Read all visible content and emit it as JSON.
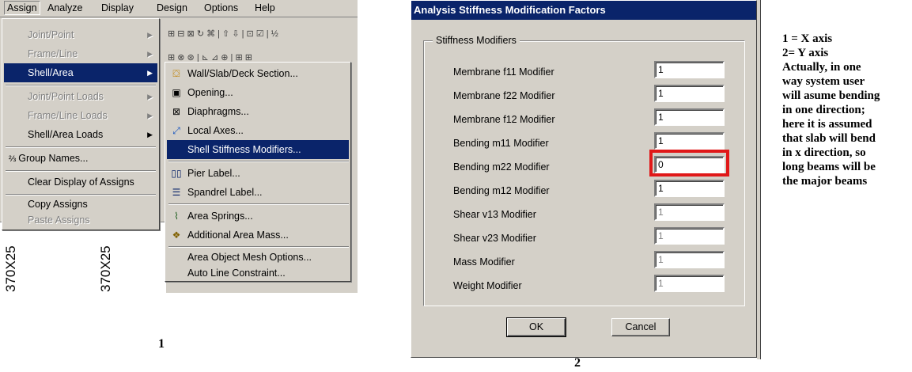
{
  "menubar": {
    "items": [
      "Assign",
      "Analyze",
      "Display",
      "Design",
      "Options",
      "Help"
    ]
  },
  "assign_menu": {
    "items": [
      {
        "label": "Joint/Point",
        "enabled": false,
        "submenu": true
      },
      {
        "label": "Frame/Line",
        "enabled": false,
        "submenu": true
      },
      {
        "label": "Shell/Area",
        "enabled": true,
        "submenu": true,
        "selected": true
      },
      {
        "label": "Joint/Point Loads",
        "enabled": false,
        "submenu": true
      },
      {
        "label": "Frame/Line Loads",
        "enabled": false,
        "submenu": true
      },
      {
        "label": "Shell/Area Loads",
        "enabled": true,
        "submenu": true
      },
      {
        "label": "Group Names...",
        "enabled": true
      },
      {
        "label": "Clear Display of Assigns",
        "enabled": true
      },
      {
        "label": "Copy Assigns",
        "enabled": true
      },
      {
        "label": "Paste Assigns",
        "enabled": false
      }
    ]
  },
  "shell_submenu": {
    "items": [
      {
        "label": "Wall/Slab/Deck Section...",
        "icon": "wall-slab-icon"
      },
      {
        "label": "Opening...",
        "icon": "opening-icon"
      },
      {
        "label": "Diaphragms...",
        "icon": "diaphragm-icon"
      },
      {
        "label": "Local Axes...",
        "icon": "local-axes-icon"
      },
      {
        "label": "Shell Stiffness Modifiers...",
        "icon": "",
        "selected": true
      },
      {
        "label": "Pier Label...",
        "icon": "pier-icon"
      },
      {
        "label": "Spandrel Label...",
        "icon": "spandrel-icon"
      },
      {
        "label": "Area Springs...",
        "icon": "springs-icon"
      },
      {
        "label": "Additional Area Mass...",
        "icon": "mass-icon"
      },
      {
        "label": "Area Object Mesh Options...",
        "icon": ""
      },
      {
        "label": "Auto Line Constraint...",
        "icon": ""
      }
    ]
  },
  "background_labels": {
    "section_a": "370X25",
    "section_b": "370X25"
  },
  "figure_labels": {
    "left": "1",
    "dialog": "2"
  },
  "dialog": {
    "title": "Analysis Stiffness Modification Factors",
    "group_label": "Stiffness Modifiers",
    "rows": [
      {
        "label": "Membrane f11 Modifier",
        "value": "1",
        "enabled": true
      },
      {
        "label": "Membrane f22 Modifier",
        "value": "1",
        "enabled": true
      },
      {
        "label": "Membrane f12 Modifier",
        "value": "1",
        "enabled": true
      },
      {
        "label": "Bending  m11 Modifier",
        "value": "1",
        "enabled": true
      },
      {
        "label": "Bending  m22 Modifier",
        "value": "0",
        "enabled": true,
        "highlighted": true
      },
      {
        "label": "Bending  m12 Modifier",
        "value": "1",
        "enabled": true
      },
      {
        "label": "Shear  v13 Modifier",
        "value": "1",
        "enabled": false
      },
      {
        "label": "Shear  v23 Modifier",
        "value": "1",
        "enabled": false
      },
      {
        "label": "Mass Modifier",
        "value": "1",
        "enabled": false
      },
      {
        "label": "Weight Modifier",
        "value": "1",
        "enabled": false
      }
    ],
    "ok_label": "OK",
    "cancel_label": "Cancel",
    "highlight_color": "#e01818"
  },
  "notes": {
    "lines": [
      "1 = X axis",
      "2= Y axis",
      "Actually, in one",
      "way system user",
      "will asume bending",
      "in one direction;",
      "here it is assumed",
      "that slab will bend",
      "in x direction, so",
      "long beams will be",
      "the major beams"
    ]
  },
  "colors": {
    "menu_bg": "#d4d0c8",
    "selection": "#0a246a"
  }
}
